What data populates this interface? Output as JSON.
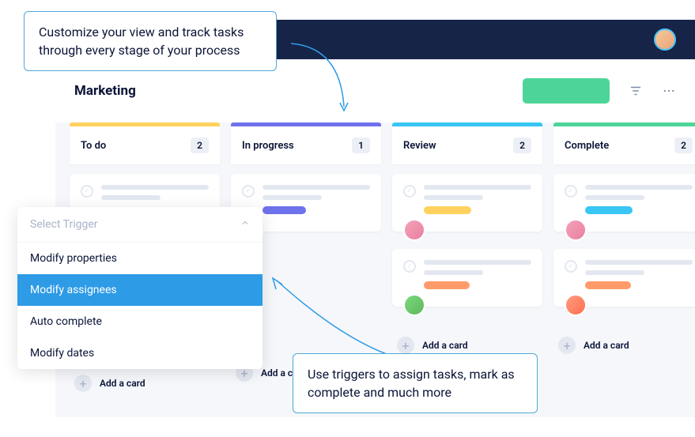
{
  "callouts": {
    "top": "Customize your view and track tasks through every stage of your process",
    "bottom": "Use triggers to assign tasks, mark as complete and much more"
  },
  "board": {
    "title": "Marketing"
  },
  "columns": [
    {
      "title": "To do",
      "count": "2",
      "stripe": "yellow"
    },
    {
      "title": "In progress",
      "count": "1",
      "stripe": "purple"
    },
    {
      "title": "Review",
      "count": "2",
      "stripe": "blue"
    },
    {
      "title": "Complete",
      "count": "2",
      "stripe": "green"
    }
  ],
  "add_card_label": "Add a card",
  "dropdown": {
    "header": "Select Trigger",
    "items": [
      {
        "label": "Modify properties",
        "selected": false
      },
      {
        "label": "Modify assignees",
        "selected": true
      },
      {
        "label": "Auto complete",
        "selected": false
      },
      {
        "label": "Modify dates",
        "selected": false
      }
    ]
  }
}
